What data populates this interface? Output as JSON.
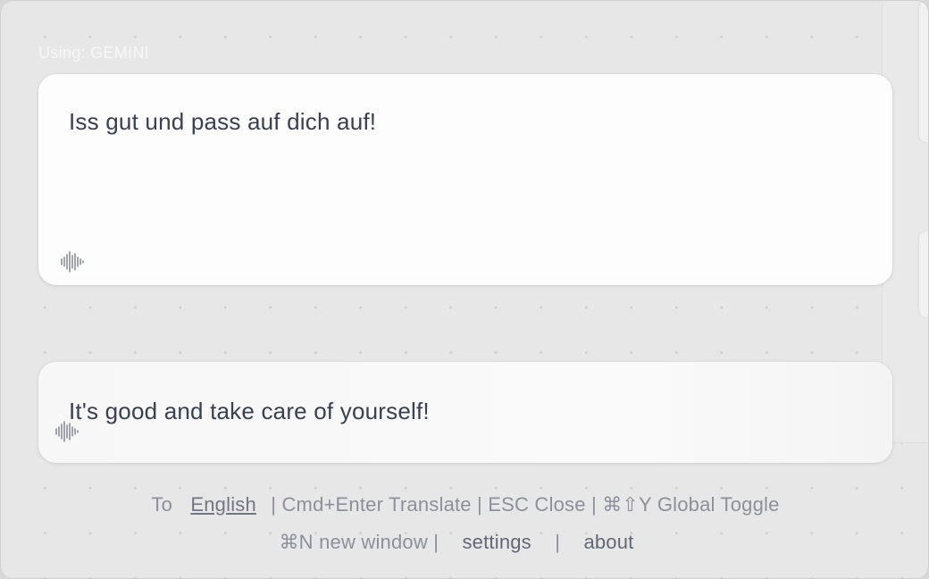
{
  "provider": {
    "label": "Using: GEMINI"
  },
  "input": {
    "text": "Iss gut und pass auf dich auf!"
  },
  "output": {
    "text": "It's good and take care of yourself!"
  },
  "icons": {
    "speak": "audio-waveform-icon"
  },
  "footer": {
    "to_label": "To",
    "target_language": "English",
    "shortcuts": "| Cmd+Enter Translate | ESC Close | ⌘⇧Y Global Toggle",
    "new_window": "⌘N new window |",
    "settings": "settings",
    "separator": "|",
    "about": "about"
  },
  "colors": {
    "text": "#394150",
    "footer_text": "#8b909a",
    "card_bg": "#fdfdfd",
    "window_bg": "#e7e7e7"
  }
}
